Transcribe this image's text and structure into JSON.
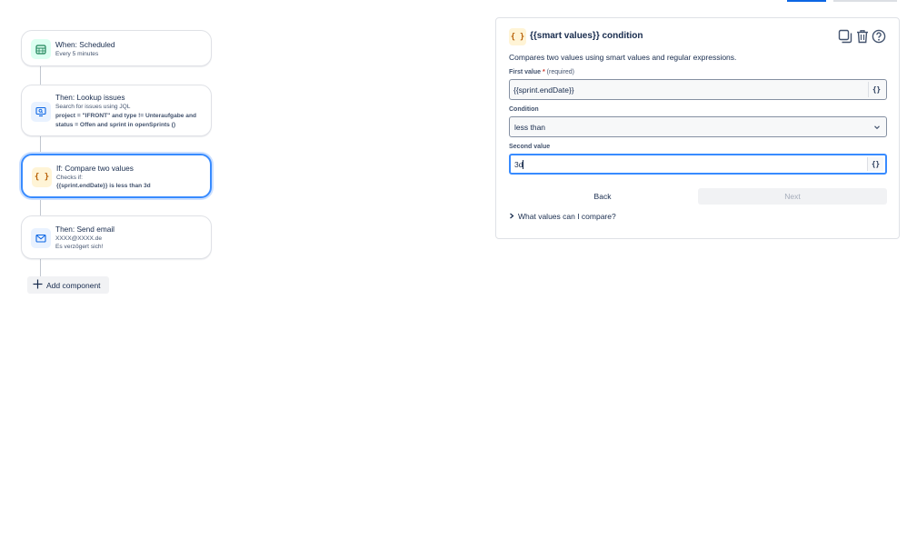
{
  "workflow": {
    "cards": [
      {
        "title": "When: Scheduled",
        "sub": "Every 5 minutes",
        "icon": "calendar-icon"
      },
      {
        "title": "Then: Lookup issues",
        "sub": "Search for issues using JQL",
        "sub2": "project = \"IFRONT\" and type != Unteraufgabe and status = Offen and sprint in openSprints ()",
        "icon": "monitor-search-icon"
      },
      {
        "title": "If: Compare two values",
        "sub": "Checks if:",
        "sub2": "{{sprint.endDate}} is less than 3d",
        "icon": "braces-icon"
      },
      {
        "title": "Then: Send email",
        "sub": "XXXX@XXXX.de",
        "sub2": "Es verzögert sich!",
        "icon": "mail-icon"
      }
    ],
    "add_component_label": "Add component"
  },
  "panel": {
    "title": "{{smart values}} condition",
    "icon": "braces-icon",
    "description": "Compares two values using smart values and regular expressions.",
    "first_value": {
      "label": "First value",
      "required_mark": "*",
      "required_text": "(required)",
      "value": "{{sprint.endDate}}",
      "brace_label": "{}"
    },
    "condition": {
      "label": "Condition",
      "value": "less than"
    },
    "second_value": {
      "label": "Second value",
      "value": "3d",
      "brace_label": "{}"
    },
    "back_label": "Back",
    "next_label": "Next",
    "help_expander": "What values can I compare?",
    "header_actions": [
      "duplicate-icon",
      "trash-icon",
      "help-icon"
    ]
  },
  "colors": {
    "accent": "#388bff",
    "primary": "#0c66e4",
    "scheduled_icon_bg": "#dcfff1",
    "lookup_icon_bg": "#e9f2ff",
    "condition_icon_bg": "#fff4d6",
    "email_icon_bg": "#e9f2ff"
  }
}
